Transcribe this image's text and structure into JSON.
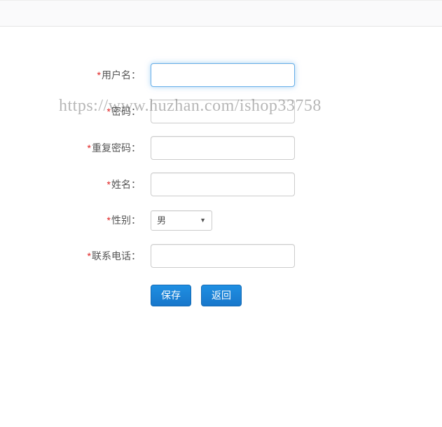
{
  "required_mark": "*",
  "labels": {
    "username": "用户名：",
    "password": "密码：",
    "repeat_password": "重复密码：",
    "name": "姓名：",
    "gender": "性别：",
    "phone": "联系电话："
  },
  "values": {
    "username": "",
    "password": "",
    "repeat_password": "",
    "name": "",
    "gender_selected": "男",
    "phone": ""
  },
  "buttons": {
    "save": "保存",
    "back": "返回"
  },
  "watermark": "https://www.huzhan.com/ishop33758"
}
